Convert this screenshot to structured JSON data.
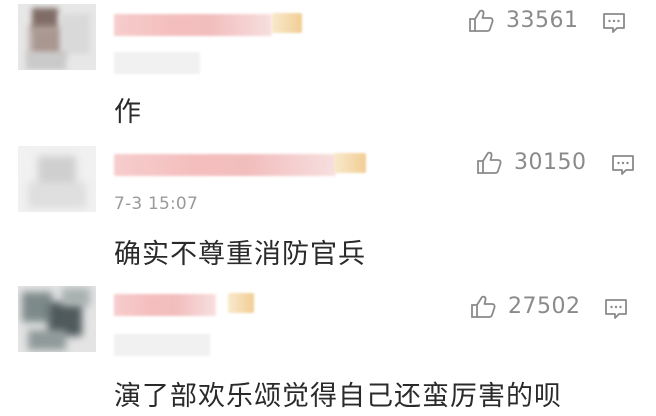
{
  "comments": [
    {
      "like_count": "33561",
      "timestamp": "",
      "text": "作"
    },
    {
      "like_count": "30150",
      "timestamp": "7-3 15:07",
      "text": "确实不尊重消防官兵"
    },
    {
      "like_count": "27502",
      "timestamp": "",
      "text": "演了部欢乐颂觉得自己还蛮厉害的呗"
    }
  ],
  "icons": {
    "like": "thumbs-up-icon",
    "reply": "comment-bubble-icon"
  },
  "colors": {
    "name_blur": "#f4b8b8",
    "badge_blur": "#f0c98a",
    "icon_gray": "#8a8a8a",
    "timestamp_gray": "#9a9a9a",
    "text": "#2a2a2a"
  }
}
